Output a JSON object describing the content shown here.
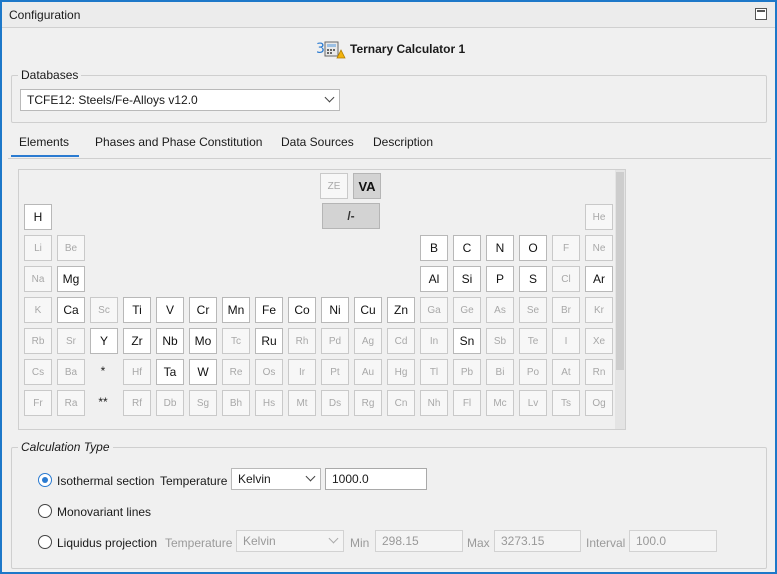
{
  "window": {
    "title": "Configuration"
  },
  "calculator": {
    "title": "Ternary Calculator 1",
    "icon": "ternary-calculator-icon"
  },
  "databases": {
    "legend": "Databases",
    "selected": "TCFE12: Steels/Fe-Alloys  v12.0"
  },
  "tabs": [
    "Elements",
    "Phases and Phase Constitution",
    "Data Sources",
    "Description"
  ],
  "elements": {
    "top": {
      "ze": "ZE",
      "va": "VA",
      "slash": "/-"
    },
    "markers": {
      "lanthanides": "*",
      "actinides": "**"
    },
    "rows": [
      [
        "H",
        "He"
      ],
      [
        "Li",
        "Be",
        "B",
        "C",
        "N",
        "O",
        "F",
        "Ne"
      ],
      [
        "Na",
        "Mg",
        "Al",
        "Si",
        "P",
        "S",
        "Cl",
        "Ar"
      ],
      [
        "K",
        "Ca",
        "Sc",
        "Ti",
        "V",
        "Cr",
        "Mn",
        "Fe",
        "Co",
        "Ni",
        "Cu",
        "Zn",
        "Ga",
        "Ge",
        "As",
        "Se",
        "Br",
        "Kr"
      ],
      [
        "Rb",
        "Sr",
        "Y",
        "Zr",
        "Nb",
        "Mo",
        "Tc",
        "Ru",
        "Rh",
        "Pd",
        "Ag",
        "Cd",
        "In",
        "Sn",
        "Sb",
        "Te",
        "I",
        "Xe"
      ],
      [
        "Cs",
        "Ba",
        "Hf",
        "Ta",
        "W",
        "Re",
        "Os",
        "Ir",
        "Pt",
        "Au",
        "Hg",
        "Tl",
        "Pb",
        "Bi",
        "Po",
        "At",
        "Rn"
      ],
      [
        "Fr",
        "Ra",
        "Rf",
        "Db",
        "Sg",
        "Bh",
        "Hs",
        "Mt",
        "Ds",
        "Rg",
        "Cn",
        "Nh",
        "Fl",
        "Mc",
        "Lv",
        "Ts",
        "Og"
      ]
    ],
    "enabled": [
      "H",
      "Mg",
      "B",
      "C",
      "N",
      "O",
      "Al",
      "Si",
      "P",
      "S",
      "Ar",
      "Ca",
      "Ti",
      "V",
      "Cr",
      "Mn",
      "Fe",
      "Co",
      "Ni",
      "Cu",
      "Zn",
      "Y",
      "Zr",
      "Nb",
      "Mo",
      "Ru",
      "Sn",
      "Ta",
      "W"
    ]
  },
  "calculation_type": {
    "legend": "Calculation Type",
    "isothermal": {
      "label": "Isothermal section",
      "temperature_label": "Temperature",
      "unit": "Kelvin",
      "value": "1000.0",
      "checked": true
    },
    "monovariant": {
      "label": "Monovariant lines"
    },
    "liquidus": {
      "label": "Liquidus projection",
      "temperature_label": "Temperature",
      "unit": "Kelvin",
      "min_label": "Min",
      "min_value": "298.15",
      "max_label": "Max",
      "max_value": "3273.15",
      "interval_label": "Interval",
      "interval_value": "100.0"
    }
  },
  "colors": {
    "accent": "#2b7bd1",
    "window_border": "#1d78c9"
  }
}
